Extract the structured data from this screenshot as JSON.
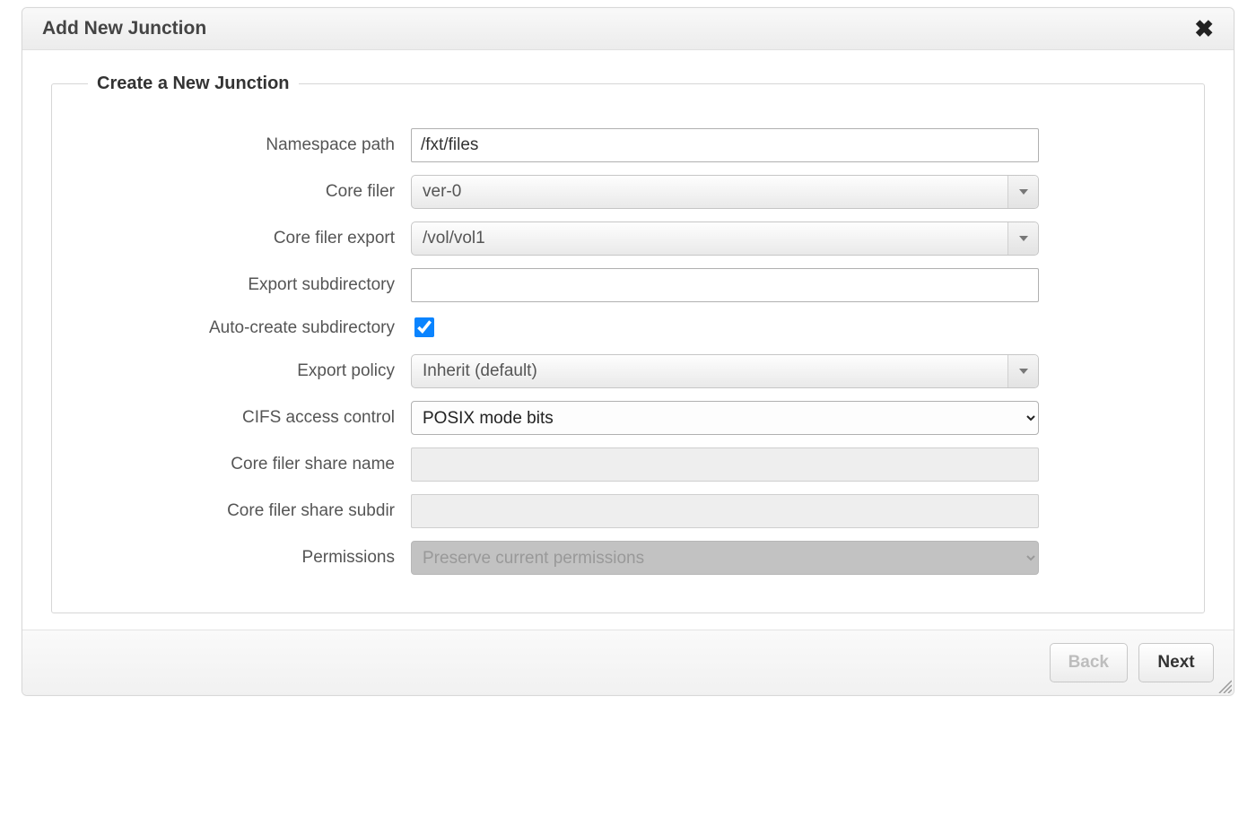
{
  "dialog": {
    "title": "Add New Junction"
  },
  "group": {
    "legend": "Create a New Junction"
  },
  "labels": {
    "namespace_path": "Namespace path",
    "core_filer": "Core filer",
    "core_filer_export": "Core filer export",
    "export_subdirectory": "Export subdirectory",
    "auto_create_subdirectory": "Auto-create subdirectory",
    "export_policy": "Export policy",
    "cifs_access_control": "CIFS access control",
    "core_filer_share_name": "Core filer share name",
    "core_filer_share_subdir": "Core filer share subdir",
    "permissions": "Permissions"
  },
  "values": {
    "namespace_path": "/fxt/files",
    "core_filer": "ver-0",
    "core_filer_export": "/vol/vol1",
    "export_subdirectory": "",
    "auto_create_subdirectory": true,
    "export_policy": "Inherit (default)",
    "cifs_access_control": "POSIX mode bits",
    "core_filer_share_name": "",
    "core_filer_share_subdir": "",
    "permissions": "Preserve current permissions"
  },
  "buttons": {
    "back": "Back",
    "next": "Next"
  }
}
